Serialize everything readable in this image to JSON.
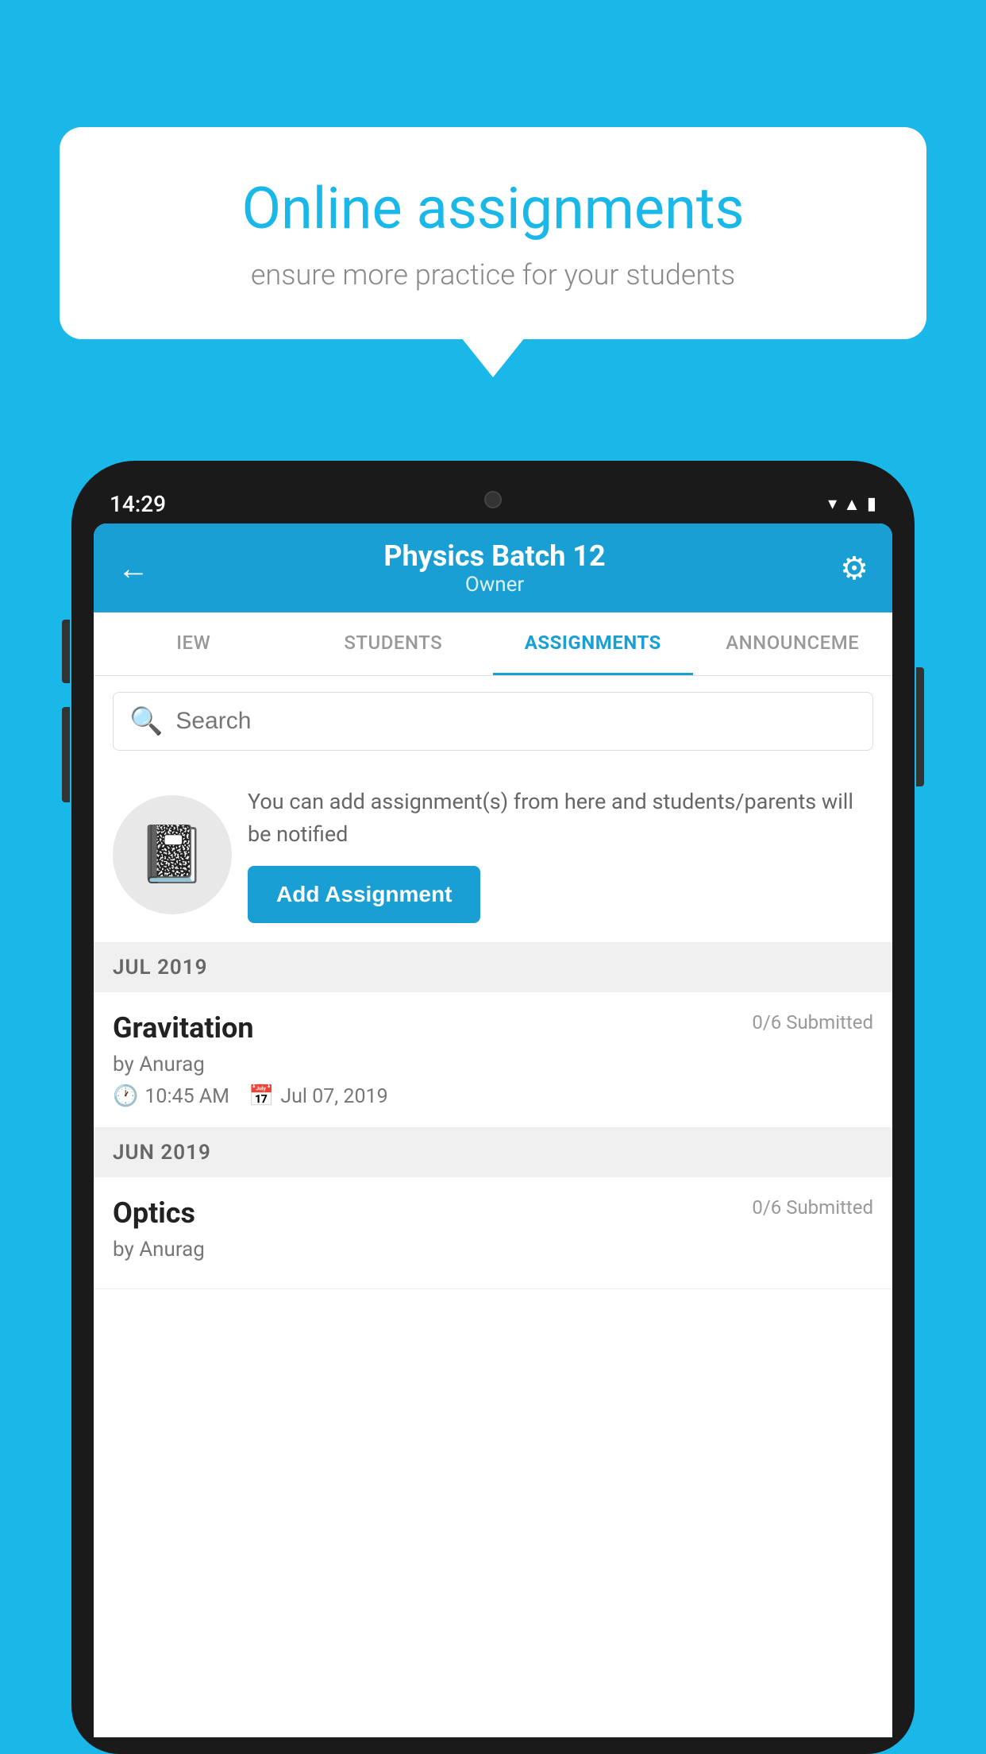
{
  "background_color": "#1ab8e8",
  "speech_bubble": {
    "title": "Online assignments",
    "subtitle": "ensure more practice for your students"
  },
  "phone": {
    "status_bar": {
      "time": "14:29",
      "icons": [
        "wifi",
        "signal",
        "battery"
      ]
    },
    "header": {
      "title": "Physics Batch 12",
      "subtitle": "Owner",
      "back_label": "←",
      "gear_label": "⚙"
    },
    "tabs": [
      {
        "label": "IEW",
        "active": false
      },
      {
        "label": "STUDENTS",
        "active": false
      },
      {
        "label": "ASSIGNMENTS",
        "active": true
      },
      {
        "label": "ANNOUNCEME",
        "active": false
      }
    ],
    "search": {
      "placeholder": "Search"
    },
    "info_banner": {
      "description": "You can add assignment(s) from here and students/parents will be notified",
      "button_label": "Add Assignment"
    },
    "sections": [
      {
        "label": "JUL 2019",
        "assignments": [
          {
            "title": "Gravitation",
            "submitted": "0/6 Submitted",
            "author": "by Anurag",
            "time": "10:45 AM",
            "date": "Jul 07, 2019"
          }
        ]
      },
      {
        "label": "JUN 2019",
        "assignments": [
          {
            "title": "Optics",
            "submitted": "0/6 Submitted",
            "author": "by Anurag",
            "time": "",
            "date": ""
          }
        ]
      }
    ]
  }
}
